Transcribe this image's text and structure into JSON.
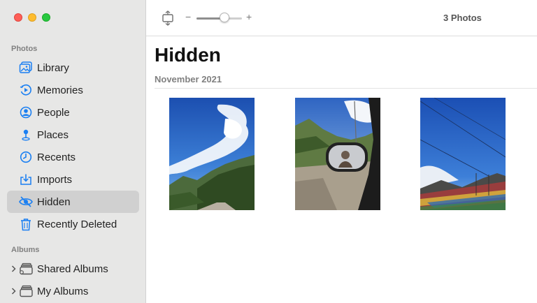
{
  "window": {
    "traffic_lights": [
      "close",
      "minimize",
      "zoom"
    ]
  },
  "sidebar": {
    "sections": [
      {
        "title": "Photos"
      },
      {
        "title": "Albums"
      }
    ],
    "items": [
      {
        "label": "Library",
        "icon": "library-icon"
      },
      {
        "label": "Memories",
        "icon": "memories-icon"
      },
      {
        "label": "People",
        "icon": "people-icon"
      },
      {
        "label": "Places",
        "icon": "places-icon"
      },
      {
        "label": "Recents",
        "icon": "recents-icon"
      },
      {
        "label": "Imports",
        "icon": "imports-icon"
      },
      {
        "label": "Hidden",
        "icon": "hidden-icon",
        "selected": true
      },
      {
        "label": "Recently Deleted",
        "icon": "trash-icon"
      }
    ],
    "albums": [
      {
        "label": "Shared Albums",
        "icon": "shared-albums-icon"
      },
      {
        "label": "My Albums",
        "icon": "my-albums-icon"
      }
    ]
  },
  "toolbar": {
    "zoom_minus": "−",
    "zoom_plus": "+",
    "zoom_level": 0.62,
    "photo_count": "3 Photos"
  },
  "main": {
    "title": "Hidden",
    "date_heading": "November 2021",
    "photos": [
      {
        "name": "photo-sky-mountain"
      },
      {
        "name": "photo-car-mirror"
      },
      {
        "name": "photo-prayer-flags"
      }
    ]
  },
  "colors": {
    "accent": "#1a7ff2",
    "sidebar_bg": "#e7e7e6",
    "selected_bg": "#d0d0d0"
  }
}
